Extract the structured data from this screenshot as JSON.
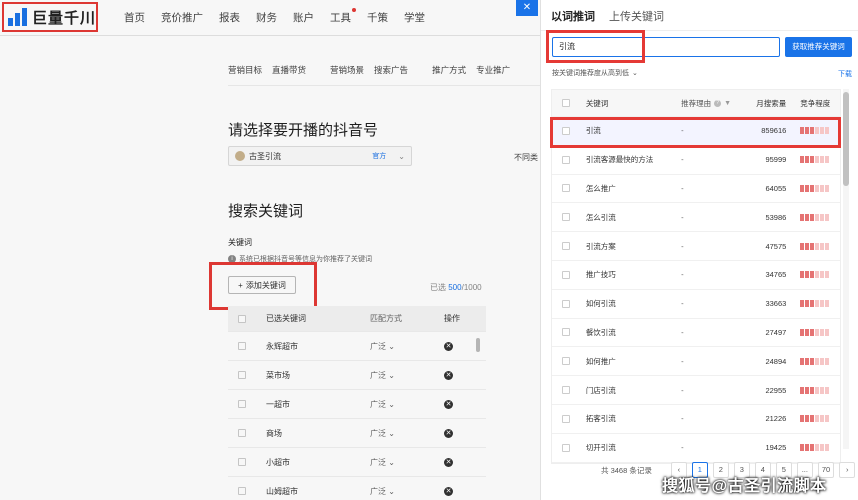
{
  "brand": {
    "name": "巨量千川"
  },
  "nav": {
    "items": [
      "首页",
      "竞价推广",
      "报表",
      "财务",
      "账户",
      "工具",
      "千策",
      "学堂"
    ]
  },
  "subtabs": {
    "items": [
      "营销目标",
      "直播带货",
      "营销场景",
      "搜索广告",
      "推广方式",
      "专业推广"
    ]
  },
  "page": {
    "account_title": "请选择要开播的抖音号",
    "account_name": "古圣引流",
    "account_tag": "官方",
    "diff_label": "不同类",
    "keywords_title": "搜索关键词",
    "keywords_label": "关键词",
    "keywords_note": "系统已根据抖音号等信息为你推荐了关键词",
    "add_keyword_label": "添加关键词",
    "counter_prefix": "已选",
    "counter_value": "500",
    "counter_total": "/1000"
  },
  "selected_table": {
    "columns": [
      "已选关键词",
      "匹配方式",
      "操作"
    ],
    "rows": [
      {
        "keyword": "永辉超市",
        "match": "广泛"
      },
      {
        "keyword": "菜市场",
        "match": "广泛"
      },
      {
        "keyword": "一超市",
        "match": "广泛"
      },
      {
        "keyword": "商场",
        "match": "广泛"
      },
      {
        "keyword": "小超市",
        "match": "广泛"
      },
      {
        "keyword": "山姆超市",
        "match": "广泛"
      }
    ]
  },
  "drawer": {
    "tabs": [
      "以词推词",
      "上传关键词"
    ],
    "search_value": "引流",
    "search_button": "获取推荐关键词",
    "sort_label": "按关键词推荐度从高到低",
    "download_label": "下载",
    "columns": [
      "关键词",
      "推荐理由",
      "月搜索量",
      "竞争程度"
    ],
    "rows": [
      {
        "keyword": "引流",
        "reason": "-",
        "volume": "859616",
        "level": 3
      },
      {
        "keyword": "引流客源最快的方法",
        "reason": "-",
        "volume": "95999",
        "level": 3
      },
      {
        "keyword": "怎么推广",
        "reason": "-",
        "volume": "64055",
        "level": 3
      },
      {
        "keyword": "怎么引流",
        "reason": "-",
        "volume": "53986",
        "level": 3
      },
      {
        "keyword": "引流方案",
        "reason": "-",
        "volume": "47575",
        "level": 3
      },
      {
        "keyword": "推广技巧",
        "reason": "-",
        "volume": "34765",
        "level": 3
      },
      {
        "keyword": "如何引流",
        "reason": "-",
        "volume": "33663",
        "level": 3
      },
      {
        "keyword": "餐饮引流",
        "reason": "-",
        "volume": "27497",
        "level": 3
      },
      {
        "keyword": "如何推广",
        "reason": "-",
        "volume": "24894",
        "level": 3
      },
      {
        "keyword": "门店引流",
        "reason": "-",
        "volume": "22955",
        "level": 3
      },
      {
        "keyword": "拓客引流",
        "reason": "-",
        "volume": "21226",
        "level": 3
      },
      {
        "keyword": "切开引流",
        "reason": "-",
        "volume": "19425",
        "level": 3
      }
    ],
    "total_text": "共 3468 条记录",
    "pages": [
      "1",
      "2",
      "3",
      "4",
      "5",
      "...",
      "70"
    ]
  },
  "watermark": "搜狐号@古圣引流脚本",
  "colors": {
    "accent": "#1a73e8",
    "highlight": "#e53935"
  }
}
